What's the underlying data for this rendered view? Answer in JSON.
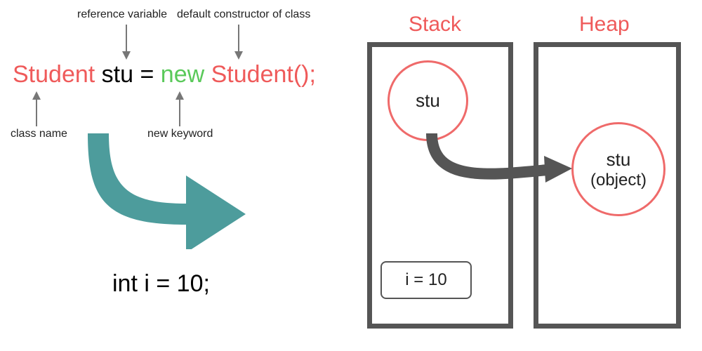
{
  "annotations": {
    "reference_variable": "reference variable",
    "default_constructor": "default constructor of class",
    "class_name": "class name",
    "new_keyword": "new keyword"
  },
  "code": {
    "class_type": "Student",
    "var_name": "stu",
    "equals": "=",
    "new_kw": "new",
    "ctor_call": "Student();"
  },
  "primitive_decl": "int i = 10;",
  "memory": {
    "stack_title": "Stack",
    "heap_title": "Heap",
    "stack_ref": "stu",
    "heap_obj_line1": "stu",
    "heap_obj_line2": "(object)",
    "stack_primitive": "i = 10"
  },
  "colors": {
    "type_color": "#ef5a5a",
    "keyword_color": "#5ac95a",
    "box_border": "#555555",
    "big_arrow": "#4d9c9c"
  }
}
